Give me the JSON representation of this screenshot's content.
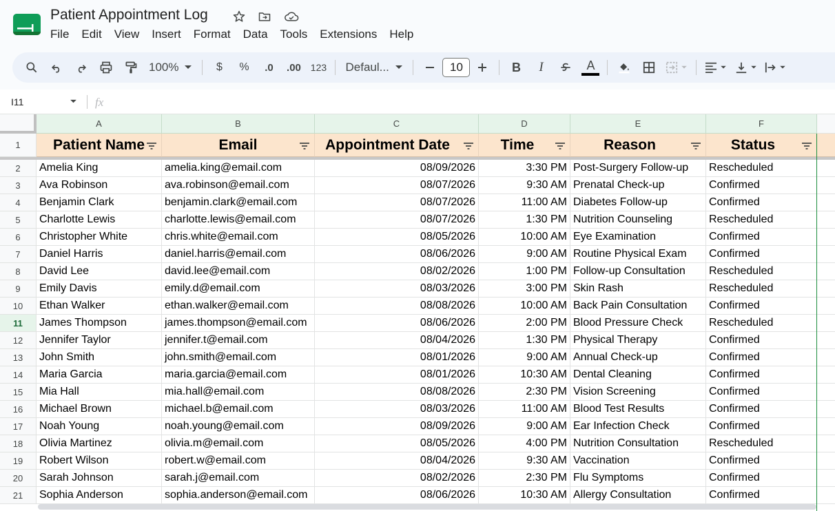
{
  "title_bar": {
    "doc_title": "Patient Appointment Log",
    "icons": [
      "star-icon",
      "move-to-folder-icon",
      "cloud-saved-icon"
    ]
  },
  "menu": [
    "File",
    "Edit",
    "View",
    "Insert",
    "Format",
    "Data",
    "Tools",
    "Extensions",
    "Help"
  ],
  "toolbar": {
    "zoom": "100%",
    "currency": "$",
    "percent": "%",
    "decrease_decimal": ".0",
    "increase_decimal": ".00",
    "number_format": "123",
    "font": "Defaul...",
    "font_size": "10",
    "bold": "B",
    "italic": "I",
    "text_color_letter": "A"
  },
  "formula_bar": {
    "cell_ref": "I11",
    "fx": "fx",
    "value": ""
  },
  "columns": [
    "A",
    "B",
    "C",
    "D",
    "E",
    "F"
  ],
  "headers": [
    "Patient Name",
    "Email",
    "Appointment Date",
    "Time",
    "Reason",
    "Status"
  ],
  "active_row": 11,
  "rows": [
    {
      "num": "2",
      "name": "Amelia King",
      "email": "amelia.king@email.com",
      "date": "08/09/2026",
      "time": "3:30 PM",
      "reason": "Post-Surgery Follow-up",
      "status": "Rescheduled"
    },
    {
      "num": "3",
      "name": "Ava Robinson",
      "email": "ava.robinson@email.com",
      "date": "08/07/2026",
      "time": "9:30 AM",
      "reason": "Prenatal Check-up",
      "status": "Confirmed"
    },
    {
      "num": "4",
      "name": "Benjamin Clark",
      "email": "benjamin.clark@email.com",
      "date": "08/07/2026",
      "time": "11:00 AM",
      "reason": "Diabetes Follow-up",
      "status": "Confirmed"
    },
    {
      "num": "5",
      "name": "Charlotte Lewis",
      "email": "charlotte.lewis@email.com",
      "date": "08/07/2026",
      "time": "1:30 PM",
      "reason": "Nutrition Counseling",
      "status": "Rescheduled"
    },
    {
      "num": "6",
      "name": "Christopher White",
      "email": "chris.white@email.com",
      "date": "08/05/2026",
      "time": "10:00 AM",
      "reason": "Eye Examination",
      "status": "Confirmed"
    },
    {
      "num": "7",
      "name": "Daniel Harris",
      "email": "daniel.harris@email.com",
      "date": "08/06/2026",
      "time": "9:00 AM",
      "reason": "Routine Physical Exam",
      "status": "Confirmed"
    },
    {
      "num": "8",
      "name": "David Lee",
      "email": "david.lee@email.com",
      "date": "08/02/2026",
      "time": "1:00 PM",
      "reason": "Follow-up Consultation",
      "status": "Rescheduled"
    },
    {
      "num": "9",
      "name": "Emily Davis",
      "email": "emily.d@email.com",
      "date": "08/03/2026",
      "time": "3:00 PM",
      "reason": "Skin Rash",
      "status": "Rescheduled"
    },
    {
      "num": "10",
      "name": "Ethan Walker",
      "email": "ethan.walker@email.com",
      "date": "08/08/2026",
      "time": "10:00 AM",
      "reason": "Back Pain Consultation",
      "status": "Confirmed"
    },
    {
      "num": "11",
      "name": "James Thompson",
      "email": "james.thompson@email.com",
      "date": "08/06/2026",
      "time": "2:00 PM",
      "reason": "Blood Pressure Check",
      "status": "Rescheduled"
    },
    {
      "num": "12",
      "name": "Jennifer Taylor",
      "email": "jennifer.t@email.com",
      "date": "08/04/2026",
      "time": "1:30 PM",
      "reason": "Physical Therapy",
      "status": "Confirmed"
    },
    {
      "num": "13",
      "name": "John Smith",
      "email": "john.smith@email.com",
      "date": "08/01/2026",
      "time": "9:00 AM",
      "reason": "Annual Check-up",
      "status": "Confirmed"
    },
    {
      "num": "14",
      "name": "Maria Garcia",
      "email": "maria.garcia@email.com",
      "date": "08/01/2026",
      "time": "10:30 AM",
      "reason": "Dental Cleaning",
      "status": "Confirmed"
    },
    {
      "num": "15",
      "name": "Mia Hall",
      "email": "mia.hall@email.com",
      "date": "08/08/2026",
      "time": "2:30 PM",
      "reason": "Vision Screening",
      "status": "Confirmed"
    },
    {
      "num": "16",
      "name": "Michael Brown",
      "email": "michael.b@email.com",
      "date": "08/03/2026",
      "time": "11:00 AM",
      "reason": "Blood Test Results",
      "status": "Confirmed"
    },
    {
      "num": "17",
      "name": "Noah Young",
      "email": "noah.young@email.com",
      "date": "08/09/2026",
      "time": "9:00 AM",
      "reason": "Ear Infection Check",
      "status": "Confirmed"
    },
    {
      "num": "18",
      "name": "Olivia Martinez",
      "email": "olivia.m@email.com",
      "date": "08/05/2026",
      "time": "4:00 PM",
      "reason": "Nutrition Consultation",
      "status": "Rescheduled"
    },
    {
      "num": "19",
      "name": "Robert Wilson",
      "email": "robert.w@email.com",
      "date": "08/04/2026",
      "time": "9:30 AM",
      "reason": "Vaccination",
      "status": "Confirmed"
    },
    {
      "num": "20",
      "name": "Sarah Johnson",
      "email": "sarah.j@email.com",
      "date": "08/02/2026",
      "time": "2:30 PM",
      "reason": "Flu Symptoms",
      "status": "Confirmed"
    },
    {
      "num": "21",
      "name": "Sophia Anderson",
      "email": "sophia.anderson@email.com",
      "date": "08/06/2026",
      "time": "10:30 AM",
      "reason": "Allergy Consultation",
      "status": "Confirmed"
    }
  ],
  "colors": {
    "header_fill": "#fce5cd",
    "column_header_fill": "#e6f4ea",
    "toolbar_bg": "#edf2fa"
  }
}
